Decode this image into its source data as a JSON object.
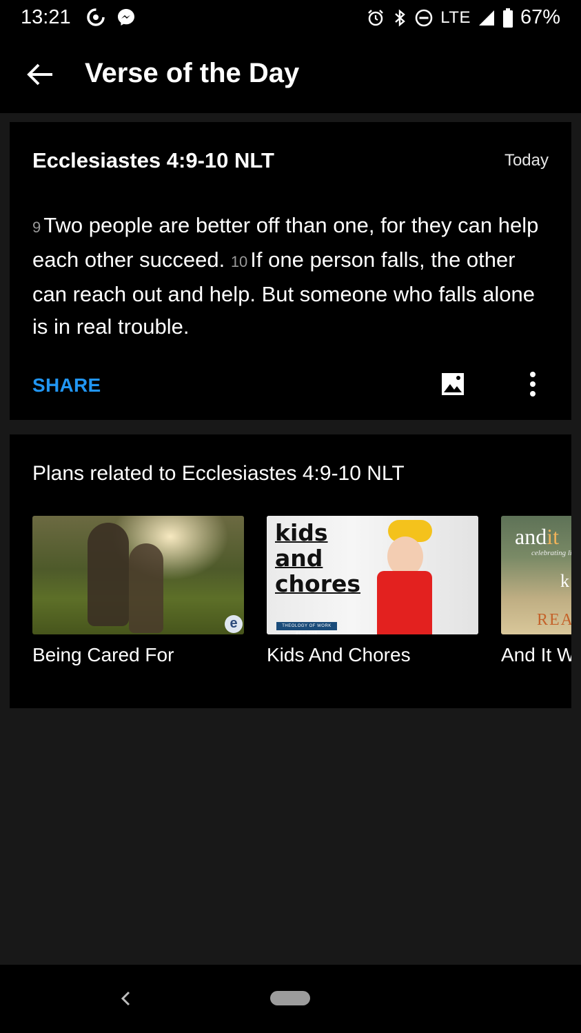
{
  "status_bar": {
    "time": "13:21",
    "network": "LTE",
    "battery": "67%"
  },
  "app_bar": {
    "title": "Verse of the Day"
  },
  "verse_card": {
    "reference": "Ecclesiastes 4:9-10 NLT",
    "date": "Today",
    "verses": [
      {
        "number": "9",
        "text": "Two people are better off than one, for they can help each other succeed."
      },
      {
        "number": "10",
        "text": "If one person falls, the other can reach out and help. But someone who falls alone is in real trouble."
      }
    ],
    "share_label": "SHARE"
  },
  "plans": {
    "heading": "Plans related to Ecclesiastes 4:9-10 NLT",
    "items": [
      {
        "title": "Being Cared For",
        "badge": "e"
      },
      {
        "title": "Kids And Chores",
        "thumb_words": [
          "kids",
          "and",
          "chores"
        ],
        "thumb_banner": "THEOLOGY OF WORK PROJECT"
      },
      {
        "title": "And It W",
        "thumb_word_a": "and",
        "thumb_word_b": "it",
        "thumb_sub": "celebrating li",
        "thumb_k": "k",
        "thumb_bottom": "REA"
      }
    ]
  },
  "colors": {
    "accent": "#2196f3",
    "background": "#181818",
    "card": "#000000"
  }
}
